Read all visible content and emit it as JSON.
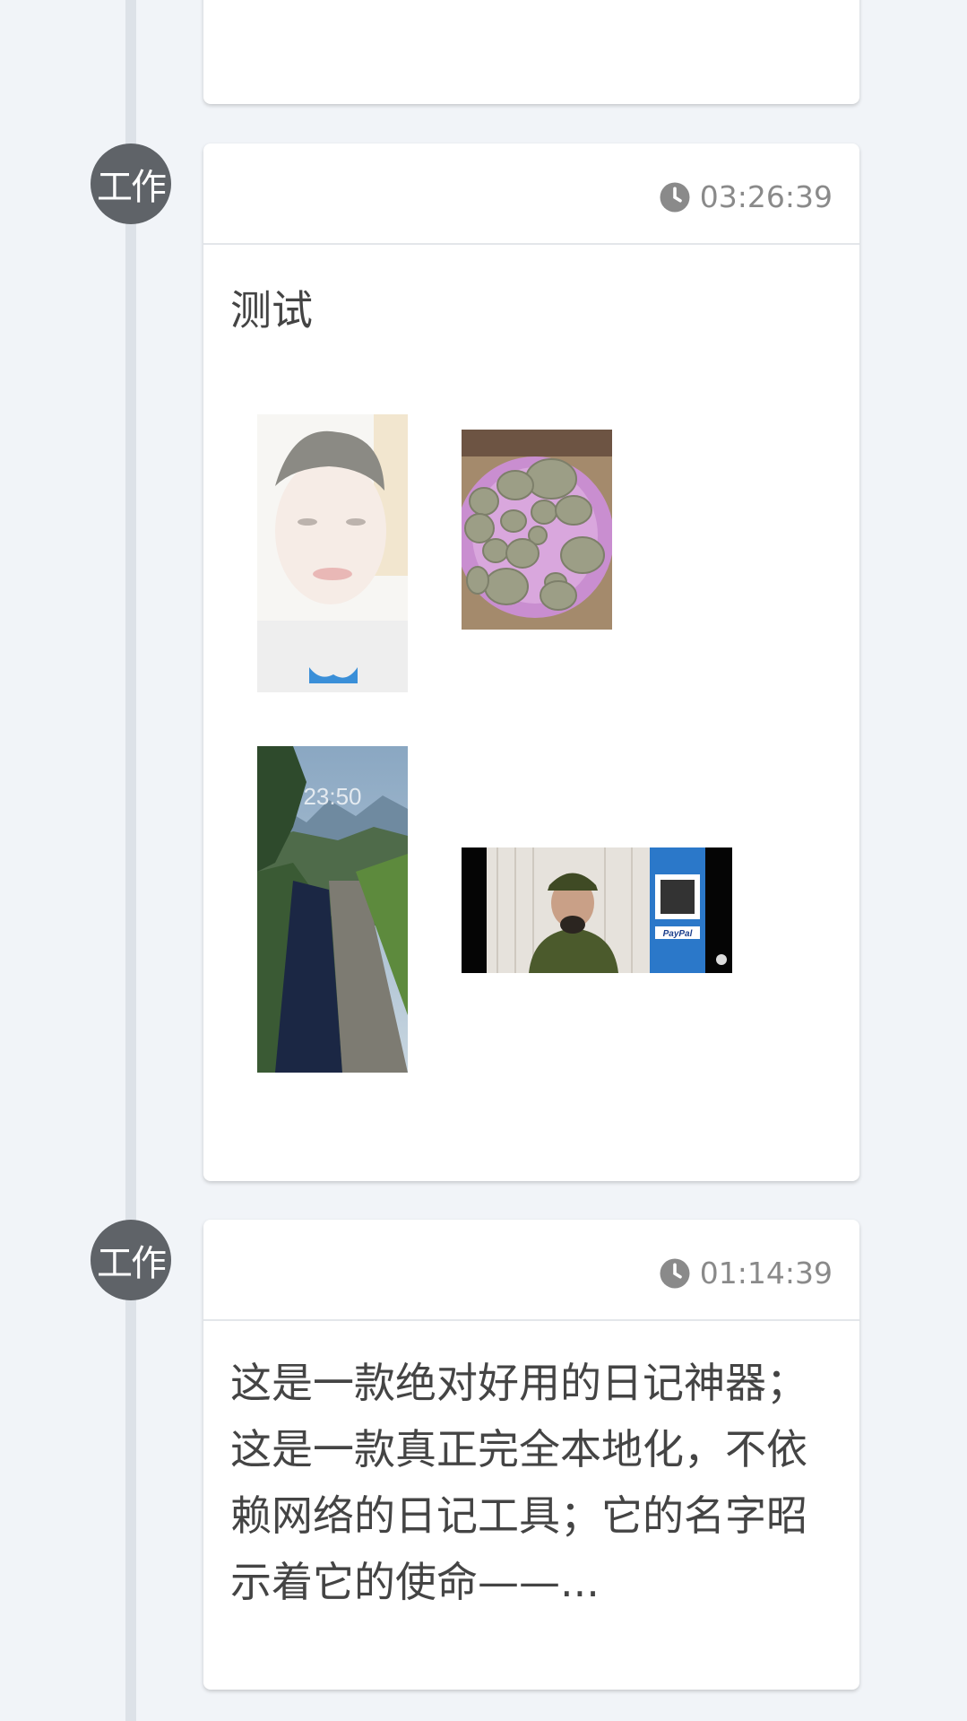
{
  "entries": [
    {
      "category": "工作",
      "time": "03:26:39",
      "title": "测试",
      "icon": "clock-icon"
    },
    {
      "category": "工作",
      "time": "01:14:39",
      "text": "这是一款绝对好用的日记神器；这是一款真正完全本地化，不依赖网络的日记工具；它的名字昭示着它的使命——..."
    }
  ],
  "photo_screen": {
    "clock": "23:50"
  },
  "photo_video": {
    "paypal_label": "PayPal"
  }
}
